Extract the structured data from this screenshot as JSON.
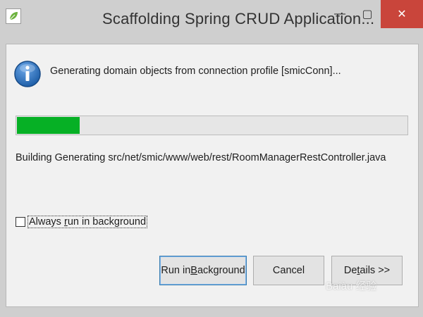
{
  "window": {
    "title": "Scaffolding Spring CRUD Application...",
    "controls": {
      "minimize": "—",
      "maximize": "▢",
      "close": "✕"
    }
  },
  "icons": {
    "app": "leaf-icon",
    "info": "info-icon"
  },
  "status": {
    "title": "Generating domain objects from connection profile [smicConn]...",
    "detail": "Building Generating src/net/smic/www/web/rest/RoomManagerRestController.java",
    "progress_fraction": 0.16
  },
  "options": {
    "always_background_label_pre": "Always ",
    "always_background_label_ul": "r",
    "always_background_label_post": "un in background",
    "always_background_checked": false
  },
  "buttons": {
    "run_bg_pre": "Run in ",
    "run_bg_ul": "B",
    "run_bg_post": "ackground",
    "cancel": "Cancel",
    "details_pre": "De",
    "details_ul": "t",
    "details_post": "ails >>"
  },
  "watermark": "Baiàu 经验",
  "colors": {
    "progress": "#06b025",
    "close": "#c9453b",
    "info": "#1f5fa8"
  }
}
